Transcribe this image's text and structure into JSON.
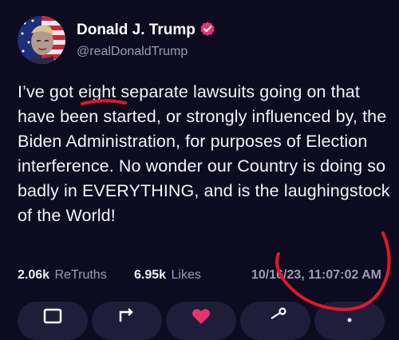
{
  "author": {
    "name": "Donald J. Trump",
    "handle": "@realDonaldTrump",
    "avatar": "portrait-avatar",
    "badge": "verified-badge-icon"
  },
  "post": {
    "text_before": "I’ve got ",
    "highlighted": "eight",
    "text_after": " separate lawsuits going on that have been started, or strongly influenced by, the Biden Administration, for purposes of Election interference. No wonder our Country is doing so badly in EVERYTHING, and is the laughingstock of the World!"
  },
  "stats": {
    "retruths_count": "2.06k",
    "retruths_label": "ReTruths",
    "likes_count": "6.95k",
    "likes_label": "Likes",
    "timestamp": "10/16/23, 11:07:02 AM"
  },
  "actions": [
    {
      "name": "reply-button",
      "icon": "reply-icon"
    },
    {
      "name": "retruth-button",
      "icon": "retruth-icon"
    },
    {
      "name": "like-button",
      "icon": "heart-icon"
    },
    {
      "name": "share-button",
      "icon": "share-icon"
    },
    {
      "name": "more-button",
      "icon": "more-icon"
    }
  ],
  "colors": {
    "background": "#0c0b20",
    "verified_badge": "#e8336b",
    "annotation_red": "#e3172b",
    "heart": "#e8336b",
    "secondary_text": "#9b9db5"
  }
}
